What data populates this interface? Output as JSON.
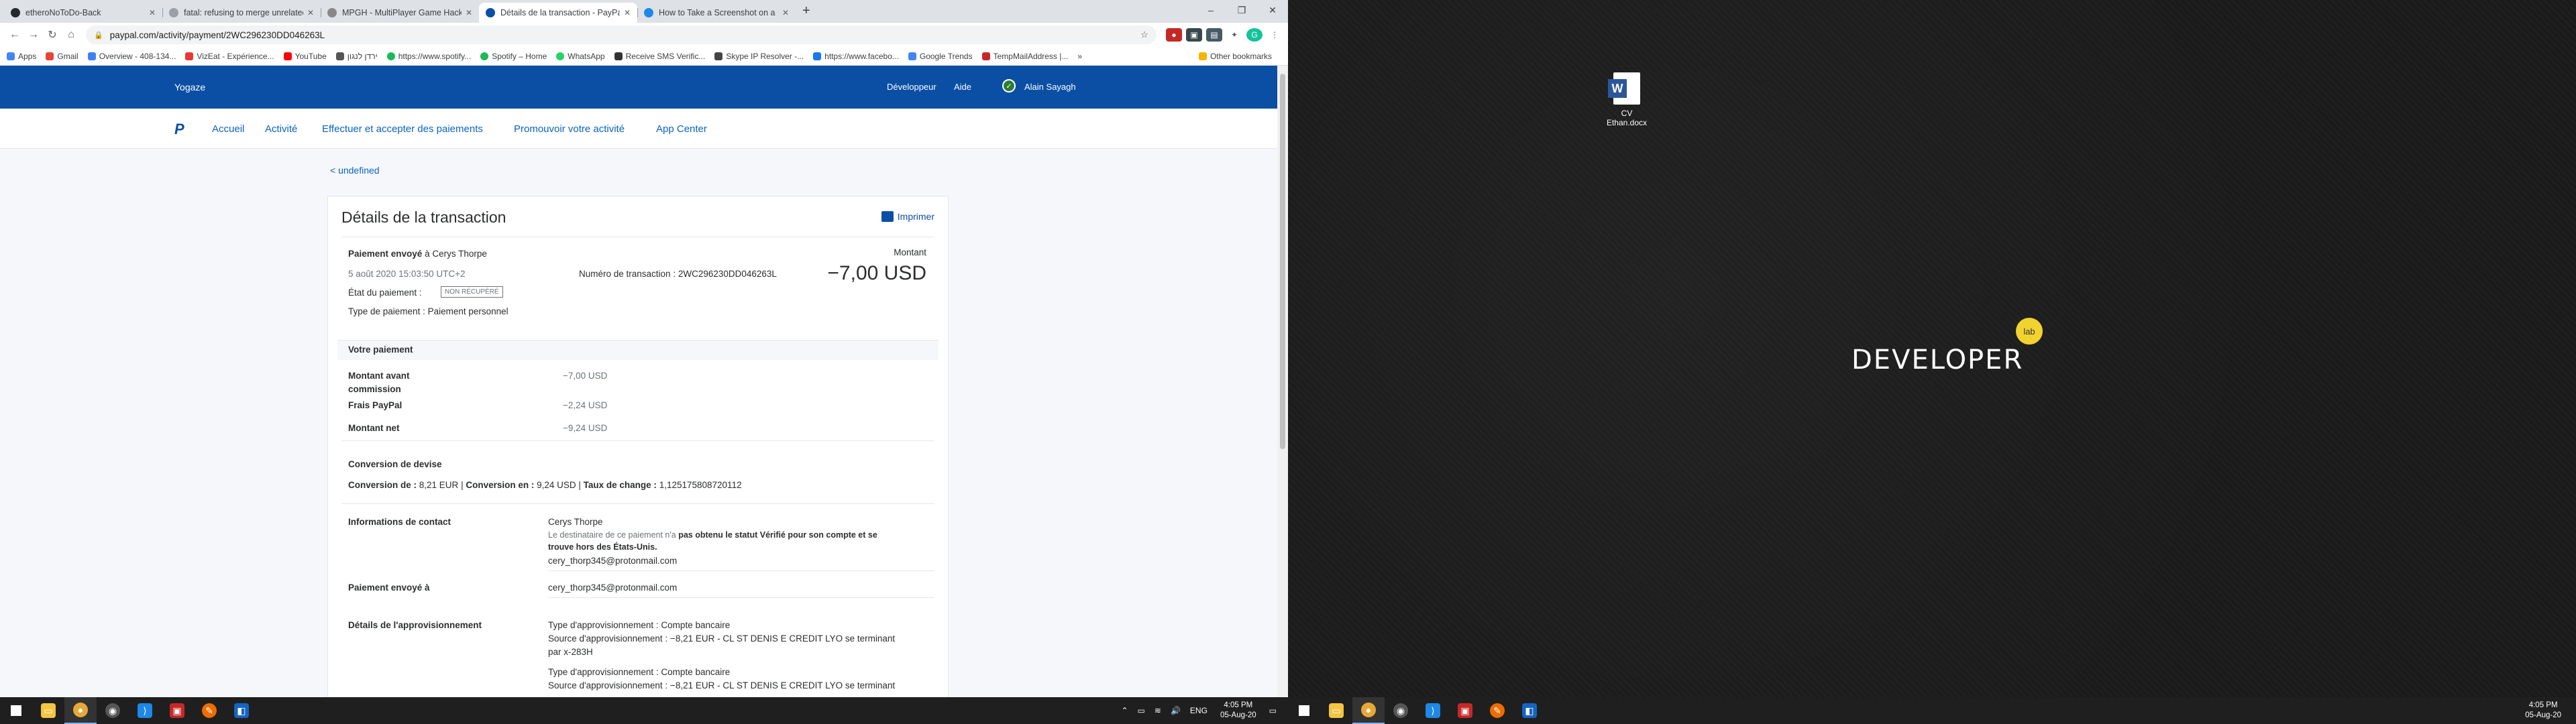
{
  "browser": {
    "tabs": [
      {
        "title": "etheroNoToDo-Back",
        "active": false,
        "favicon_color": "#24292e"
      },
      {
        "title": "fatal: refusing to merge unrelated",
        "active": false,
        "favicon_color": "#9aa0a6"
      },
      {
        "title": "MPGH - MultiPlayer Game Hacking",
        "active": false,
        "favicon_color": "#888888"
      },
      {
        "title": "Détails de la transaction - PayPal",
        "active": true,
        "favicon_color": "#0b4fa5"
      },
      {
        "title": "How to Take a Screenshot on a",
        "active": false,
        "favicon_color": "#1e88e5"
      }
    ],
    "url": "paypal.com/activity/payment/2WC296230DD046263L",
    "bookmarks": [
      {
        "label": "Apps",
        "color": "#4285f4"
      },
      {
        "label": "Gmail",
        "color": "#ea4335"
      },
      {
        "label": "Overview - 408-134...",
        "color": "#3b82f6"
      },
      {
        "label": "VizEat - Expérience...",
        "color": "#e53935"
      },
      {
        "label": "YouTube",
        "color": "#ff0000"
      },
      {
        "label": "ירדן לנגון",
        "color": "#555555"
      },
      {
        "label": "https://www.spotify...",
        "color": "#1db954"
      },
      {
        "label": "Spotify – Home",
        "color": "#1db954"
      },
      {
        "label": "WhatsApp",
        "color": "#25d366"
      },
      {
        "label": "Receive SMS Verific...",
        "color": "#333333"
      },
      {
        "label": "Skype IP Resolver -...",
        "color": "#444444"
      },
      {
        "label": "https://www.facebo...",
        "color": "#1877f2"
      },
      {
        "label": "Google Trends",
        "color": "#4285f4"
      },
      {
        "label": "TempMailAddress |...",
        "color": "#c62828"
      }
    ],
    "other_bookmarks": "Other bookmarks"
  },
  "paypal": {
    "brand": "Yogaze",
    "developer": "Développeur",
    "help": "Aide",
    "user": "Alain Sayagh",
    "nav": [
      "Accueil",
      "Activité",
      "Effectuer et accepter des paiements",
      "Promouvoir votre activité",
      "App Center"
    ],
    "back": "< undefined",
    "title": "Détails de la transaction",
    "print": "Imprimer",
    "sent_label": "Paiement envoyé",
    "recipient_prefix": "à Cerys Thorpe",
    "date": "5 août 2020 15:03:50 UTC+2",
    "txn_label": "Numéro de transaction : 2WC296230DD046263L",
    "status_label": "État du paiement :",
    "status_badge": "NON RÉCUPÉRÉ",
    "type_label": "Type de paiement : Paiement personnel",
    "amount_label": "Montant",
    "amount": "−7,00 USD",
    "your_payment": "Votre paiement",
    "rows": [
      {
        "label": "Montant avant",
        "label2": "commission",
        "value": "−7,00 USD"
      },
      {
        "label": "Frais PayPal",
        "label2": "",
        "value": "−2,24 USD"
      },
      {
        "label": "Montant net",
        "label2": "",
        "value": "−9,24 USD"
      }
    ],
    "conversion_title": "Conversion de devise",
    "conversion_from_label": "Conversion de :",
    "conversion_from": "8,21 EUR",
    "conversion_to_label": "Conversion en :",
    "conversion_to": "9,24 USD",
    "rate_label": "Taux de change :",
    "rate": "1,125175808720112",
    "contact_label": "Informations de contact",
    "contact_name": "Cerys Thorpe",
    "contact_note_a": "Le destinataire de ce paiement n'a",
    "contact_note_b": "pas obtenu le statut Vérifié pour son compte et se",
    "contact_note_c": "trouve hors des États-Unis.",
    "contact_email": "cery_thorp345@protonmail.com",
    "sent_to_label": "Paiement envoyé à",
    "sent_to_email": "cery_thorp345@protonmail.com",
    "funding_label": "Détails de l'approvisionnement",
    "funding": [
      {
        "type": "Type d'approvisionnement : Compte bancaire",
        "source": "Source d'approvisionnement : −8,21 EUR - CL ST DENIS E CREDIT LYO se terminant",
        "source2": "par x-283H"
      },
      {
        "type": "Type d'approvisionnement : Compte bancaire",
        "source": "Source d'approvisionnement : −8,21 EUR - CL ST DENIS E CREDIT LYO se terminant",
        "source2": ""
      }
    ]
  },
  "desktop": {
    "file_label_1": "CV",
    "file_label_2": "Ethan.docx",
    "logo_text": "DEVELOPER",
    "logo_bubble": "lab"
  },
  "taskbar": {
    "lang": "ENG",
    "time": "4:05 PM",
    "date": "05-Aug-20"
  }
}
